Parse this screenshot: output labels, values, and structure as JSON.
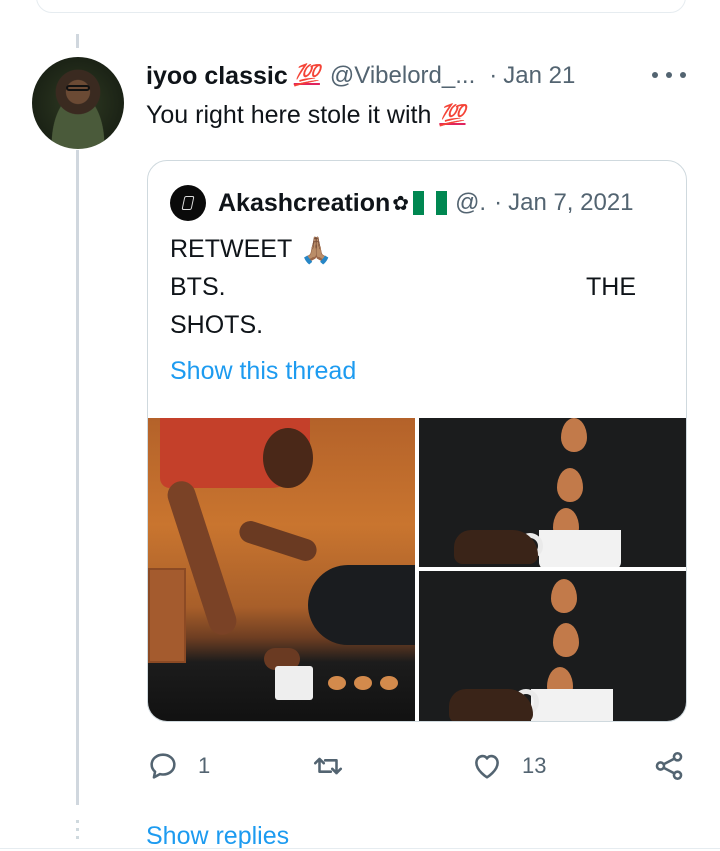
{
  "tweet": {
    "display_name": "iyoo classic",
    "name_badge": "💯",
    "handle": "@Vibelord_...",
    "separator": "·",
    "time": "Jan 21",
    "text": "You right here stole it with",
    "text_badge": "💯"
  },
  "quoted_tweet": {
    "display_name": "Akashcreation",
    "name_flower": "✿",
    "handle": "@.",
    "separator": "·",
    "time": "Jan 7, 2021",
    "line1": "RETWEET",
    "line1_emoji": "🙏🏽",
    "line2_left": "BTS.",
    "line2_right": "THE",
    "line3": "SHOTS.",
    "show_thread": "Show this thread"
  },
  "actions": {
    "reply_count": "1",
    "retweet_count": "",
    "like_count": "13"
  },
  "footer": {
    "show_replies": "Show replies"
  },
  "colors": {
    "link": "#1d9bf0",
    "muted": "#536471",
    "hundred": "#e0245e",
    "flag_green": "#008751",
    "flag_white": "#ffffff"
  }
}
